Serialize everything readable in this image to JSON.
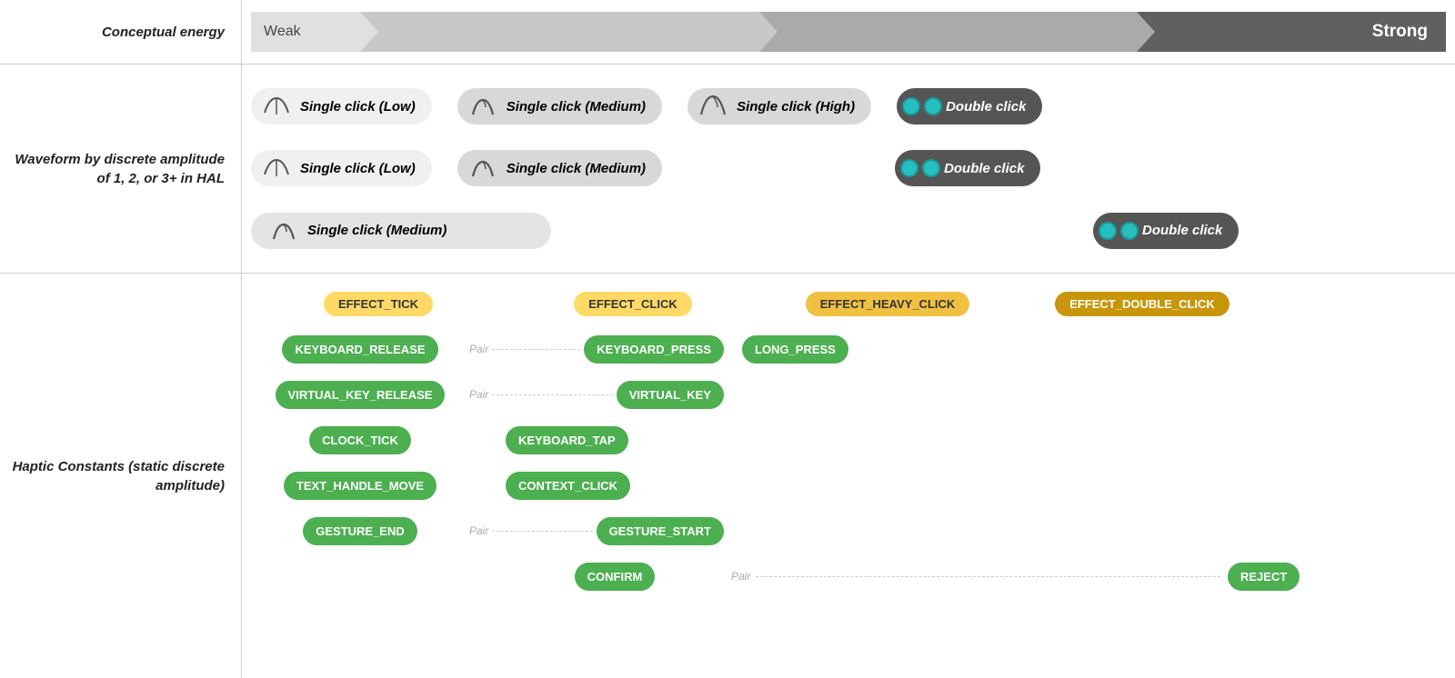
{
  "labels": {
    "conceptual_energy": "Conceptual energy",
    "weak": "Weak",
    "strong": "Strong",
    "waveform_label": "Waveform by discrete amplitude of 1, 2, or 3+ in HAL",
    "haptic_label": "Haptic Constants (static discrete amplitude)"
  },
  "waveforms": {
    "row1": [
      {
        "type": "low",
        "label": "Single click (Low)"
      },
      {
        "type": "medium",
        "label": "Single click (Medium)"
      },
      {
        "type": "high",
        "label": "Single click (High)"
      },
      {
        "type": "double",
        "label": "Double click"
      }
    ],
    "row2": [
      {
        "type": "low",
        "label": "Single click (Low)"
      },
      {
        "type": "medium",
        "label": "Single click (Medium)"
      },
      {
        "type": "double",
        "label": "Double click"
      }
    ],
    "row3": [
      {
        "type": "medium",
        "label": "Single click (Medium)"
      },
      {
        "type": "double",
        "label": "Double click"
      }
    ]
  },
  "effects": {
    "tick": "EFFECT_TICK",
    "click": "EFFECT_CLICK",
    "heavy_click": "EFFECT_HEAVY_CLICK",
    "double_click": "EFFECT_DOUBLE_CLICK"
  },
  "constants": {
    "keyboard_release": "KEYBOARD_RELEASE",
    "keyboard_press": "KEYBOARD_PRESS",
    "long_press": "LONG_PRESS",
    "virtual_key_release": "VIRTUAL_KEY_RELEASE",
    "virtual_key": "VIRTUAL_KEY",
    "clock_tick": "CLOCK_TICK",
    "keyboard_tap": "KEYBOARD_TAP",
    "text_handle_move": "TEXT_HANDLE_MOVE",
    "context_click": "CONTEXT_CLICK",
    "gesture_end": "GESTURE_END",
    "gesture_start": "GESTURE_START",
    "confirm": "CONFIRM",
    "reject": "REJECT",
    "pair": "Pair"
  }
}
